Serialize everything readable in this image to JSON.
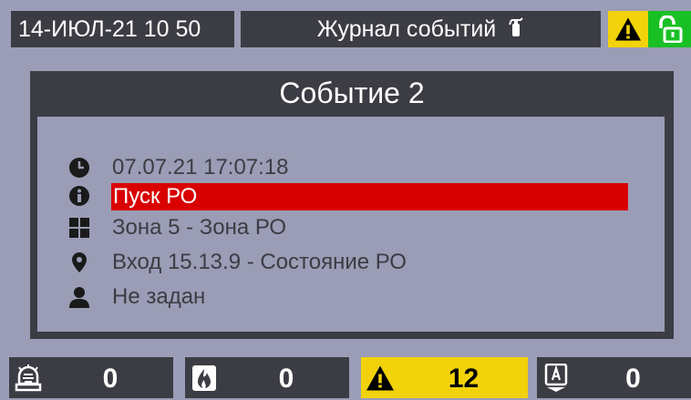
{
  "header": {
    "datetime": "14-ИЮЛ-21  10 50",
    "title": "Журнал событий",
    "title_icon": "fire-extinguisher-icon",
    "warning_icon": "warning-icon",
    "lock_icon": "unlocked-icon",
    "warning_color": "#f2d20a",
    "lock_color": "#19c024"
  },
  "event": {
    "title": "Событие 2",
    "timestamp": "07.07.21  17:07:18",
    "type": "Пуск РО",
    "zone": "Зона 5 - Зона РО",
    "input": "Вход 15.13.9 - Состояние РО",
    "user": "Не задан",
    "highlight_color": "#d90000"
  },
  "counters": [
    {
      "icon": "alarm-siren-icon",
      "value": "0"
    },
    {
      "icon": "fire-icon",
      "value": "0"
    },
    {
      "icon": "warning-icon",
      "value": "12",
      "color": "#f2d20a"
    },
    {
      "icon": "fault-icon",
      "value": "0"
    }
  ]
}
